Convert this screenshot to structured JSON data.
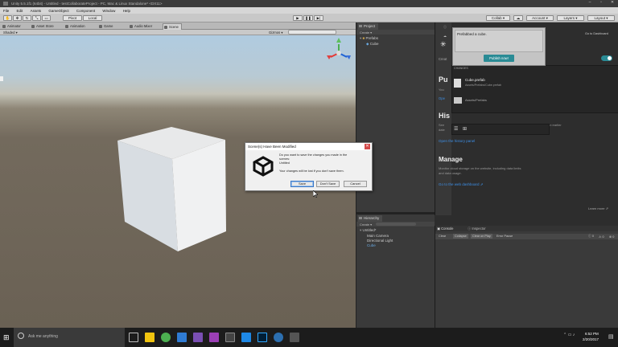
{
  "window": {
    "title": "Unity 5.5.1f1 (64bit) - Untitled - testCollaborateProject - PC, Mac & Linux Standalone* <DX11>"
  },
  "menu": [
    "File",
    "Edit",
    "Assets",
    "GameObject",
    "Component",
    "Window",
    "Help"
  ],
  "toolbar": {
    "pivot": "Pivot",
    "local": "Local",
    "collab": "Collab",
    "account": "Account",
    "layers": "Layers",
    "layout": "Layout"
  },
  "scene_tabs": [
    "Animator",
    "Asset Store",
    "Animation",
    "Game",
    "Audio Mixer",
    "Scene"
  ],
  "scene_options": {
    "shaded": "Shaded",
    "gizmos": "Gizmos"
  },
  "project": {
    "tab": "Project",
    "create": "Create",
    "folder": "Prefabs",
    "item": "Cube"
  },
  "hierarchy": {
    "tab": "Hierarchy",
    "create": "Create",
    "scene": "Untitled*",
    "items": [
      "Main Camera",
      "Directional Light",
      "Cube"
    ]
  },
  "collab": {
    "go_to_dashboard": "Go to Dashboard",
    "header_fragment": "Creat",
    "publish_heading": "Pu",
    "publish_line1": "You",
    "publish_line2": "Ope",
    "changes_label": "CHANGES",
    "changes": [
      {
        "name": "Cube.prefab",
        "path": "Assets/Prefabs/Cube.prefab"
      },
      {
        "name": "Prefabs",
        "path": "Assets/Prefabs"
      }
    ],
    "history_heading": "His",
    "history_line": "See",
    "history_suffix": "an earlier",
    "history_suffix2": "date",
    "history_link": "Open the history panel",
    "manage_heading": "Manage",
    "manage_text1": "Monitor cloud storage on the website, including data limits",
    "manage_text2": "and data usage.",
    "manage_link": "Go to the web dashboard",
    "learn_more": "Learn more"
  },
  "popup": {
    "message": "Prefabbed a cube.",
    "button": "Publish now!"
  },
  "dialog": {
    "title": "Scene(s) Have Been Modified",
    "line1": "Do you want to save the changes you made in the",
    "line2": "scenes:",
    "line3": "Untitled",
    "line4": "Your changes will be lost if you don't save them.",
    "save": "Save",
    "dont_save": "Don't Save",
    "cancel": "Cancel"
  },
  "console": {
    "tab_console": "Console",
    "tab_inspector": "Inspector",
    "clear": "Clear",
    "collapse": "Collapse",
    "clear_on_play": "Clear on Play",
    "error_pause": "Error Pause",
    "count": "0"
  },
  "taskbar": {
    "search_placeholder": "Ask me anything",
    "time": "6:52 PM",
    "date": "2/20/2017"
  },
  "colors": {
    "accent_teal": "#2a8b95",
    "link_blue": "#3d8ee4",
    "dialog_primary": "#3a78c8"
  }
}
